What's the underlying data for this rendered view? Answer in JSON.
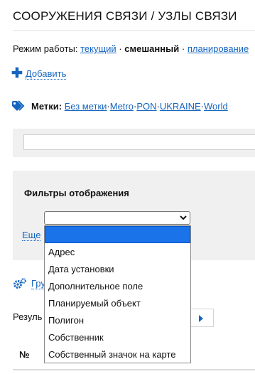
{
  "header": {
    "title": "СООРУЖЕНИЯ СВЯЗИ / УЗЛЫ СВЯЗИ"
  },
  "mode": {
    "label": "Режим работы:",
    "options": [
      "текущий",
      "смешанный",
      "планирование"
    ],
    "separator": "·"
  },
  "add": {
    "label": "Добавить"
  },
  "tags": {
    "label": "Метки:",
    "items": [
      "Без метки",
      "Metro",
      "PON",
      "UKRAINE",
      "World"
    ],
    "separator": "·"
  },
  "filters": {
    "title": "Фильтры отображения",
    "more_label": "Еще",
    "select_options": [
      "",
      "Адрес",
      "Дата установки",
      "Дополнительное поле",
      "Планируемый объект",
      "Полигон",
      "Собственник",
      "Собственный значок на карте"
    ]
  },
  "group": {
    "label": "Гру"
  },
  "results": {
    "label": "Резуль"
  },
  "table": {
    "col_number": "№"
  },
  "colors": {
    "link": "#1565c0",
    "selected_option": "#1a73e8",
    "panel": "#f0f0f0"
  }
}
